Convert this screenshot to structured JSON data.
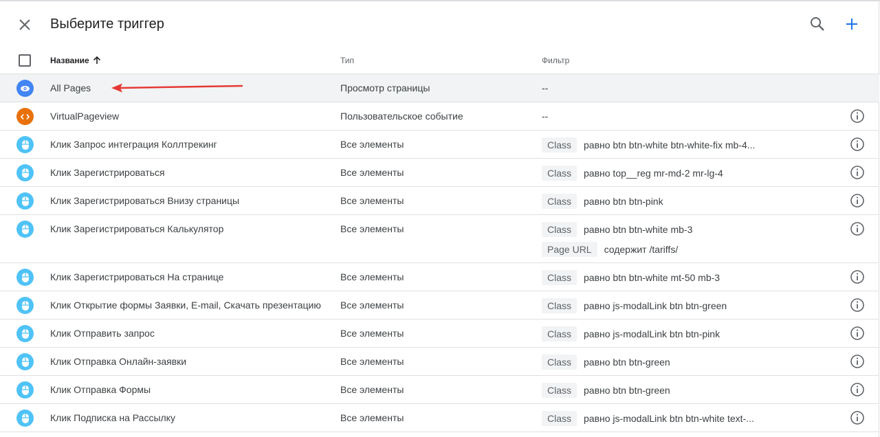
{
  "header": {
    "title": "Выберите триггер"
  },
  "icons": {
    "close": "close-icon",
    "search": "search-icon",
    "add": "plus-icon",
    "sort": "arrow-up-icon",
    "info": "info-icon"
  },
  "colors": {
    "page_view": "#4285f4",
    "custom_event": "#e8710a",
    "click": "#4fc3f7",
    "annotation_arrow": "#e53935"
  },
  "table": {
    "columns": {
      "name": "Название",
      "type": "Тип",
      "filter": "Фильтр"
    },
    "rows": [
      {
        "name": "All Pages",
        "type": "Просмотр страницы",
        "filter_text": "--"
      },
      {
        "name": "VirtualPageview",
        "type": "Пользовательское событие",
        "filter_text": "--"
      },
      {
        "name": "Клик Запрос интеграция Коллтрекинг",
        "type": "Все элементы",
        "f1_chip": "Class",
        "f1_text": "равно btn btn-white btn-white-fix mb-4..."
      },
      {
        "name": "Клик Зарегистрироваться",
        "type": "Все элементы",
        "f1_chip": "Class",
        "f1_text": "равно top__reg mr-md-2 mr-lg-4"
      },
      {
        "name": "Клик Зарегистрироваться Внизу страницы",
        "type": "Все элементы",
        "f1_chip": "Class",
        "f1_text": "равно btn btn-pink"
      },
      {
        "name": "Клик Зарегистрироваться Калькулятор",
        "type": "Все элементы",
        "f1_chip": "Class",
        "f1_text": "равно btn btn-white mb-3",
        "f2_chip": "Page URL",
        "f2_text": "содержит /tariffs/"
      },
      {
        "name": "Клик Зарегистрироваться На странице",
        "type": "Все элементы",
        "f1_chip": "Class",
        "f1_text": "равно btn btn-white mt-50 mb-3"
      },
      {
        "name": "Клик Открытие формы Заявки, E-mail, Скачать презентацию",
        "type": "Все элементы",
        "f1_chip": "Class",
        "f1_text": "равно js-modalLink btn btn-green"
      },
      {
        "name": "Клик Отправить запрос",
        "type": "Все элементы",
        "f1_chip": "Class",
        "f1_text": "равно js-modalLink btn btn-pink"
      },
      {
        "name": "Клик Отправка Онлайн-заявки",
        "type": "Все элементы",
        "f1_chip": "Class",
        "f1_text": "равно btn btn-green"
      },
      {
        "name": "Клик Отправка Формы",
        "type": "Все элементы",
        "f1_chip": "Class",
        "f1_text": "равно btn btn-green"
      },
      {
        "name": "Клик Подписка на Рассылку",
        "type": "Все элементы",
        "f1_chip": "Class",
        "f1_text": "равно js-modalLink btn btn-white text-..."
      }
    ]
  }
}
